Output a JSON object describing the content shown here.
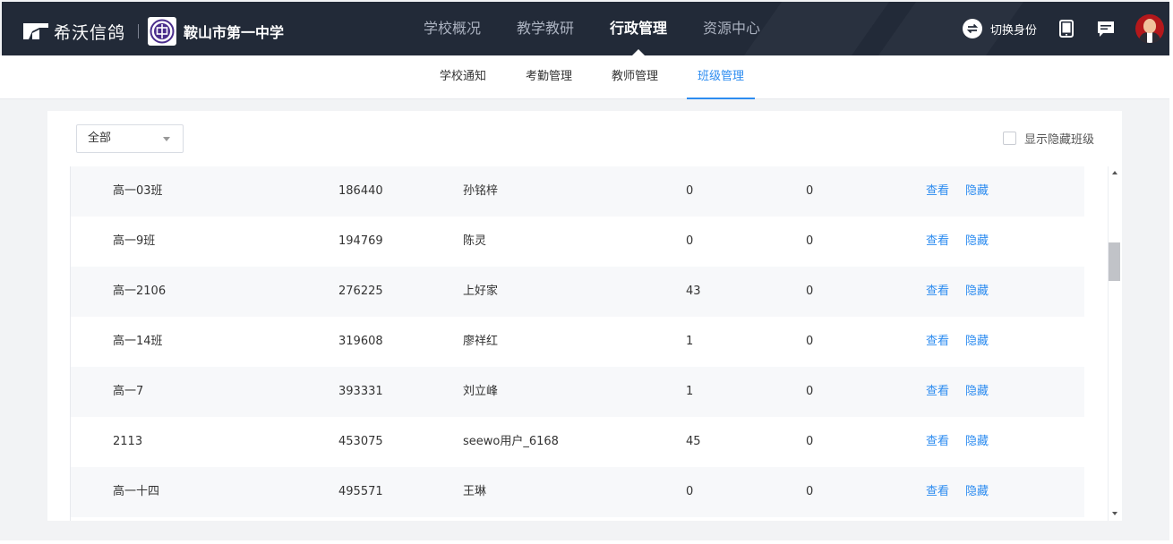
{
  "brand": {
    "name": "希沃信鸽",
    "school_name": "鞍山市第一中学"
  },
  "colors": {
    "topbar": "#222a38",
    "accent": "#2d8cf0",
    "link": "#2d8cf0"
  },
  "main_nav": [
    {
      "label": "学校概况",
      "active": false
    },
    {
      "label": "教学教研",
      "active": false
    },
    {
      "label": "行政管理",
      "active": true
    },
    {
      "label": "资源中心",
      "active": false
    }
  ],
  "top_actions": {
    "switch_identity_label": "切换身份",
    "icons": [
      "switch-identity-icon",
      "tablet-icon",
      "message-icon",
      "avatar"
    ]
  },
  "sub_nav": [
    {
      "label": "学校通知",
      "active": false
    },
    {
      "label": "考勤管理",
      "active": false
    },
    {
      "label": "教师管理",
      "active": false
    },
    {
      "label": "班级管理",
      "active": true
    }
  ],
  "filter": {
    "selected": "全部"
  },
  "show_hidden": {
    "label": "显示隐藏班级",
    "checked": false
  },
  "rows": [
    {
      "name": "高一03班",
      "code": "186440",
      "teacher": "孙铭梓",
      "students": "0",
      "other": "0",
      "view": "查看",
      "hide": "隐藏"
    },
    {
      "name": "高一9班",
      "code": "194769",
      "teacher": "陈灵",
      "students": "0",
      "other": "0",
      "view": "查看",
      "hide": "隐藏"
    },
    {
      "name": "高一2106",
      "code": "276225",
      "teacher": "上好家",
      "students": "43",
      "other": "0",
      "view": "查看",
      "hide": "隐藏"
    },
    {
      "name": "高一14班",
      "code": "319608",
      "teacher": "廖祥红",
      "students": "1",
      "other": "0",
      "view": "查看",
      "hide": "隐藏"
    },
    {
      "name": "高一7",
      "code": "393331",
      "teacher": "刘立峰",
      "students": "1",
      "other": "0",
      "view": "查看",
      "hide": "隐藏"
    },
    {
      "name": "2113",
      "code": "453075",
      "teacher": "seewo用户_6168",
      "students": "45",
      "other": "0",
      "view": "查看",
      "hide": "隐藏"
    },
    {
      "name": "高一十四",
      "code": "495571",
      "teacher": "王琳",
      "students": "0",
      "other": "0",
      "view": "查看",
      "hide": "隐藏"
    }
  ]
}
